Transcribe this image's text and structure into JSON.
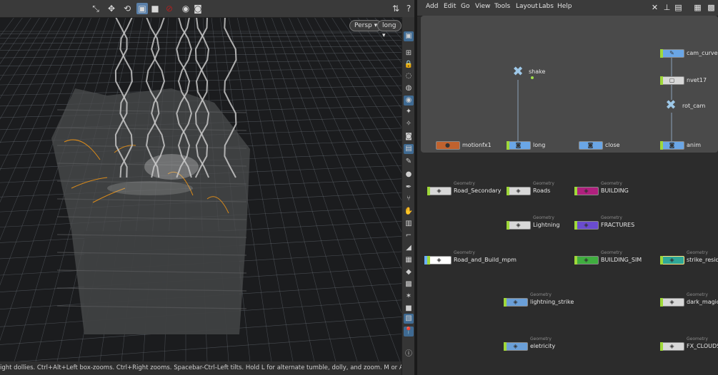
{
  "viewport": {
    "camera_menu": "Persp",
    "display_menu": "long",
    "status_text": "ight dollies. Ctrl+Alt+Left box-zooms. Ctrl+Right zooms. Spacebar-Ctrl-Left tilts. Hold L for alternate tumble, dolly, and zoom. M or Alt+M for First Person Navigation.",
    "toolbar_icons": [
      "select-icon",
      "move-icon",
      "rotate-icon",
      "scale-icon",
      "stop-icon",
      "no-entry-icon",
      "snapshot-icon",
      "camera-icon",
      "settings-icon",
      "help-icon"
    ],
    "shelf_icons": [
      "view-icon",
      "layers-icon",
      "lock-icon",
      "ghost-icon",
      "sphere-icon",
      "light-icon",
      "bulb-icon",
      "bulb2-icon",
      "camera-icon",
      "render-icon",
      "paint-icon",
      "dot-icon",
      "pen-icon",
      "nodes-icon",
      "hand-icon",
      "stack-icon",
      "corner-icon",
      "wedge-icon",
      "box-icon",
      "diamond-icon",
      "image-icon",
      "sparkle-icon",
      "square-icon",
      "grid-icon",
      "pin-icon",
      "info-icon"
    ]
  },
  "network": {
    "menus": [
      "Add",
      "Edit",
      "Go",
      "View",
      "Tools",
      "Layout",
      "Labs",
      "Help"
    ],
    "colors": {
      "background": "#2c2c2c",
      "network_box": "#4a4a4a",
      "wire": "#8aa0b8",
      "flag": "#9fd83a"
    },
    "box_nodes": {
      "shake": "shake",
      "cam_curve": "cam_curve",
      "null17": "nvet17",
      "rot_cam": "rot_cam",
      "motionfx1": "motionfx1",
      "long": "long",
      "close": "close",
      "anim": "anim"
    },
    "geo_nodes": [
      {
        "type": "Geometry",
        "label": "Road_Secondary",
        "color": "#d8d8d8"
      },
      {
        "type": "Geometry",
        "label": "Roads",
        "color": "#d8d8d8"
      },
      {
        "type": "Geometry",
        "label": "BUILDING",
        "color": "#b0207e"
      },
      {
        "type": "Geometry",
        "label": "Lightning",
        "color": "#d8d8d8"
      },
      {
        "type": "Geometry",
        "label": "FRACTURES",
        "color": "#6a4ccf"
      },
      {
        "type": "Geometry",
        "label": "Road_and_Build_mpm",
        "color": "#ffffff"
      },
      {
        "type": "Geometry",
        "label": "BUILDING_SIM",
        "color": "#3fae3f"
      },
      {
        "type": "Geometry",
        "label": "strike_residue",
        "color": "#2fa898"
      },
      {
        "type": "Geometry",
        "label": "lightning_strike",
        "color": "#6a9fd8"
      },
      {
        "type": "Geometry",
        "label": "dark_magic",
        "color": "#d8d8d8"
      },
      {
        "type": "Geometry",
        "label": "eletricity",
        "color": "#6a9fd8"
      },
      {
        "type": "Geometry",
        "label": "FX_CLOUDS",
        "color": "#d8d8d8"
      }
    ]
  }
}
